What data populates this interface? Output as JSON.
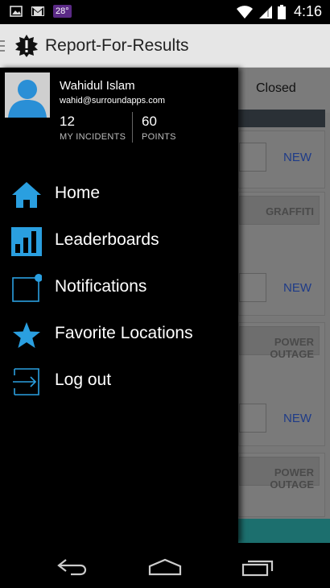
{
  "status_bar": {
    "badge": "28°",
    "time": "4:16",
    "icons": [
      "image-icon",
      "gmail-icon",
      "wifi-icon",
      "signal-icon",
      "battery-icon"
    ]
  },
  "action_bar": {
    "title": "Report-For-Results",
    "icon": "alert-badge-icon"
  },
  "background": {
    "tab_label": "Closed",
    "cards": [
      {
        "category": "",
        "status": "NEW"
      },
      {
        "category": "GRAFFITI",
        "status": "NEW"
      },
      {
        "category": "POWER OUTAGE",
        "status": "NEW"
      },
      {
        "category": "POWER OUTAGE",
        "status": ""
      }
    ]
  },
  "drawer": {
    "user": {
      "name": "Wahidul Islam",
      "email": "wahid@surroundapps.com"
    },
    "stats": {
      "incidents_value": "12",
      "incidents_label": "MY INCIDENTS",
      "points_value": "60",
      "points_label": "POINTS"
    },
    "items": [
      {
        "label": "Home",
        "icon": "home-icon"
      },
      {
        "label": "Leaderboards",
        "icon": "bar-chart-icon"
      },
      {
        "label": "Notifications",
        "icon": "notification-icon"
      },
      {
        "label": "Favorite Locations",
        "icon": "star-icon"
      },
      {
        "label": "Log out",
        "icon": "logout-icon"
      }
    ]
  },
  "colors": {
    "accent": "#2a9fe0",
    "action_bar": "#e6e6e6",
    "drawer": "#000000",
    "new_link": "#1e3b88"
  },
  "nav_bar": {
    "buttons": [
      "back-icon",
      "home-nav-icon",
      "recents-icon"
    ]
  }
}
